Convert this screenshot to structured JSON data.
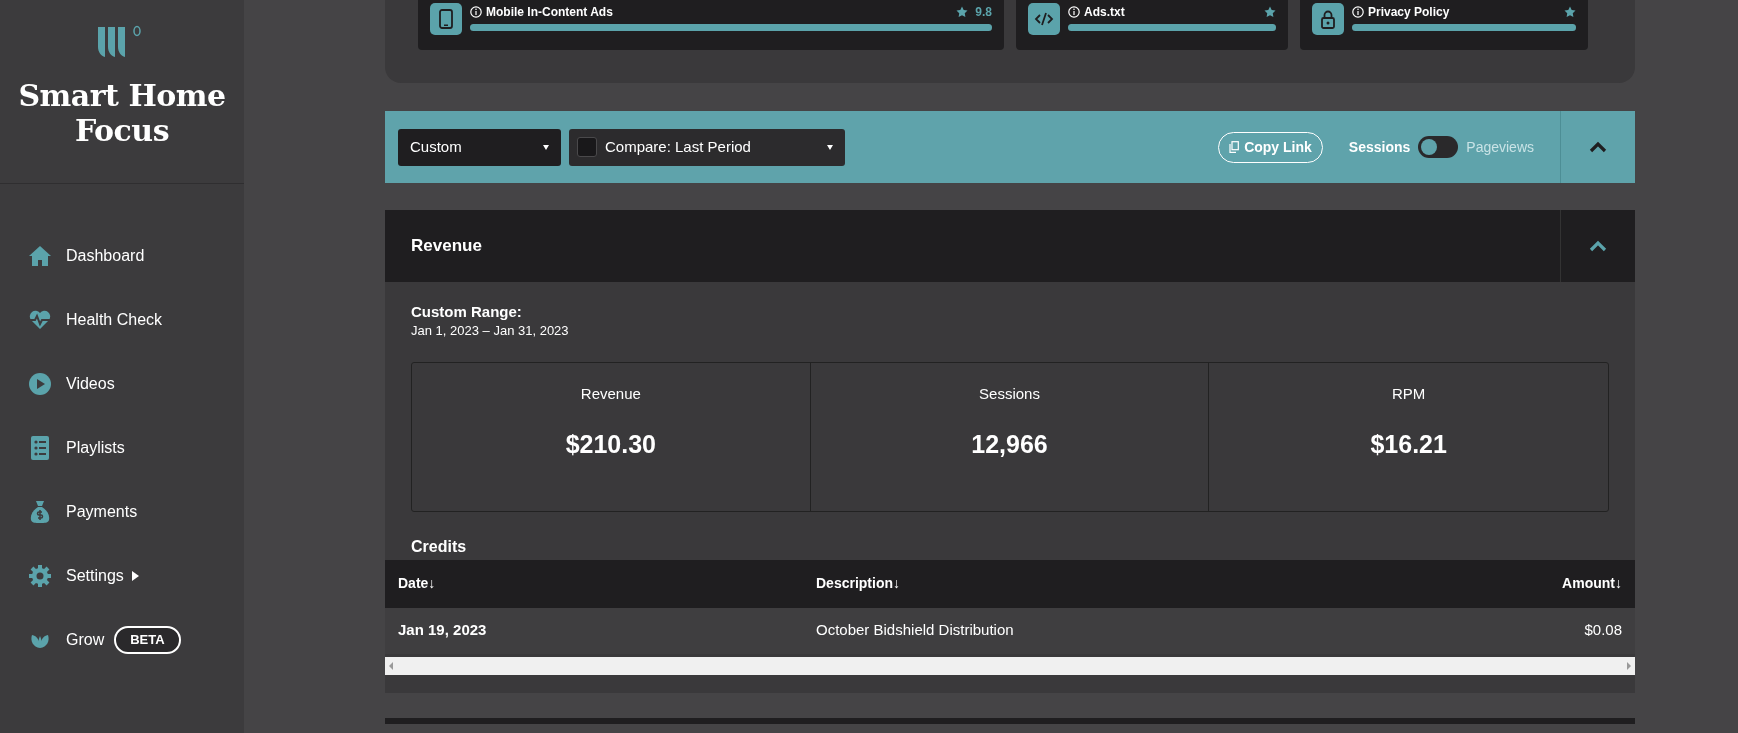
{
  "sidebar": {
    "brand": "Smart Home Focus",
    "items": [
      {
        "label": "Dashboard",
        "selected": false
      },
      {
        "label": "Health Check",
        "selected": false
      },
      {
        "label": "Videos",
        "selected": false
      },
      {
        "label": "Playlists",
        "selected": false
      },
      {
        "label": "Payments",
        "selected": false
      },
      {
        "label": "Settings",
        "selected": false,
        "has_submenu": true
      },
      {
        "label": "Grow",
        "selected": false,
        "badge": "BETA"
      }
    ]
  },
  "checks": [
    {
      "title": "Mobile In-Content Ads",
      "score": "9.8",
      "level": 1
    },
    {
      "title": "Ads.txt",
      "level": 1
    },
    {
      "title": "Privacy Policy",
      "level": 1
    }
  ],
  "toolbar": {
    "date_range": "Custom",
    "compare": {
      "label": "Compare: Last Period",
      "checked": false
    },
    "copy_link": "Copy Link",
    "toggle": {
      "left": "Sessions",
      "right": "Pageviews",
      "on": false
    },
    "expanded": true
  },
  "revenue": {
    "title": "Revenue",
    "expanded": true,
    "range_label": "Custom Range:",
    "range": "Jan 1, 2023 – Jan 31, 2023",
    "stats": [
      {
        "label": "Revenue",
        "value": "$210.30"
      },
      {
        "label": "Sessions",
        "value": "12,966"
      },
      {
        "label": "RPM",
        "value": "$16.21"
      }
    ],
    "credits": {
      "title": "Credits",
      "columns": [
        {
          "label": "Date↓"
        },
        {
          "label": "Description↓"
        },
        {
          "label": "Amount↓"
        }
      ],
      "rows": [
        [
          "Jan 19, 2023",
          "October Bidshield Distribution",
          "$0.08"
        ]
      ]
    }
  }
}
